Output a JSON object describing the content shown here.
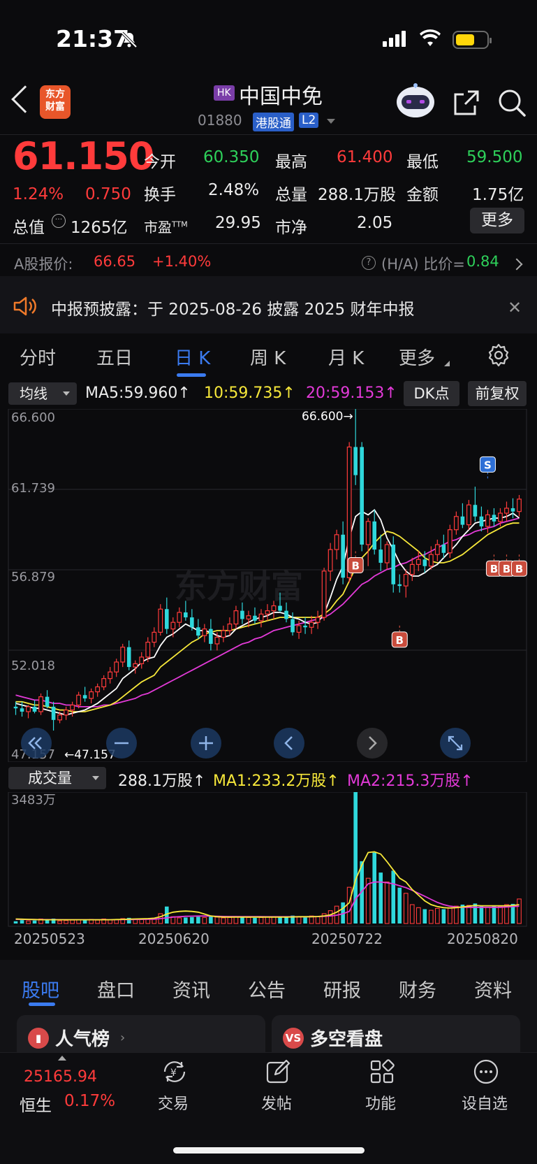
{
  "status": {
    "time": "21:37"
  },
  "header": {
    "logo_line1": "东方",
    "logo_line2": "财富",
    "market_badge": "HK",
    "name": "中国中免",
    "code": "01880",
    "connect_badge": "港股通",
    "level_badge": "L2"
  },
  "quote": {
    "price": "61.150",
    "change_pct": "1.24%",
    "change": "0.750",
    "open_label": "今开",
    "open": "60.350",
    "high_label": "最高",
    "high": "61.400",
    "low_label": "最低",
    "low": "59.500",
    "turnover_label": "换手",
    "turnover": "2.48%",
    "volume_label": "总量",
    "volume": "288.1万股",
    "amount_label": "金额",
    "amount": "1.75亿",
    "mktcap_label": "总值",
    "mktcap": "1265亿",
    "pe_label": "市盈",
    "pe_sup": "TTM",
    "pe": "29.95",
    "pb_label": "市净",
    "pb": "2.05",
    "more": "更多"
  },
  "ashare": {
    "label": "A股报价:",
    "price": "66.65",
    "pct": "+1.40%",
    "ratio_label": "(H/A) 比价=",
    "ratio": "0.84"
  },
  "notice": {
    "text": "中报预披露：于 2025-08-26 披露 2025 财年中报"
  },
  "period_tabs": [
    "分时",
    "五日",
    "日 K",
    "周 K",
    "月 K",
    "更多"
  ],
  "indicator": {
    "select": "均线",
    "ma5": "MA5:59.960↑",
    "ma10": "10:59.735↑",
    "ma20": "20:59.153↑",
    "dk": "DK点",
    "adjust": "前复权"
  },
  "price_axis": {
    "top": "66.600",
    "l2": "61.739",
    "l3": "56.879",
    "l4": "52.018",
    "bottom": "47.157",
    "max_marker": "66.600→",
    "min_marker": "←47.157",
    "watermark": "东方财富"
  },
  "signals": {
    "buy": "B",
    "sell": "S"
  },
  "volume": {
    "select": "成交量",
    "vol": "288.1万股↑",
    "ma1": "MA1:233.2万股↑",
    "ma2": "MA2:215.3万股↑",
    "axis_top": "3483万"
  },
  "dates": [
    "20250523",
    "20250620",
    "20250722",
    "20250820"
  ],
  "bottom_tabs": [
    "股吧",
    "盘口",
    "资讯",
    "公告",
    "研报",
    "财务",
    "资料"
  ],
  "cards": [
    {
      "title": "人气榜",
      "icon": "hot"
    },
    {
      "title": "多空看盘",
      "icon": "VS"
    }
  ],
  "tabbar": {
    "index_value": "25165.94",
    "index_name": "恒生",
    "index_pct": "0.17%",
    "items": [
      "交易",
      "发帖",
      "功能",
      "设自选"
    ]
  },
  "colors": {
    "up": "#ff3b3b",
    "down": "#2ed05a",
    "accent": "#3b7bf0",
    "ma5": "#ffffff",
    "ma10": "#f7e83a",
    "ma20": "#e33ad8",
    "candle_down": "#2fd8dc"
  },
  "chart_data": {
    "type": "candlestick",
    "ylim": [
      47.157,
      66.6
    ],
    "candles": [
      [
        48.6,
        48.9,
        48.1,
        48.5
      ],
      [
        48.5,
        48.9,
        48.0,
        48.3
      ],
      [
        48.3,
        48.7,
        47.9,
        48.6
      ],
      [
        48.6,
        49.0,
        48.2,
        48.3
      ],
      [
        48.3,
        49.4,
        48.1,
        49.2
      ],
      [
        49.2,
        49.6,
        48.5,
        48.6
      ],
      [
        48.6,
        48.9,
        47.157,
        47.8
      ],
      [
        47.8,
        48.3,
        47.6,
        48.1
      ],
      [
        48.1,
        48.6,
        47.8,
        48.4
      ],
      [
        48.4,
        48.9,
        48.0,
        48.7
      ],
      [
        48.7,
        49.5,
        48.5,
        49.3
      ],
      [
        49.3,
        49.8,
        48.9,
        49.1
      ],
      [
        49.1,
        49.7,
        48.8,
        49.5
      ],
      [
        49.5,
        50.0,
        49.2,
        49.8
      ],
      [
        49.8,
        50.5,
        49.6,
        50.3
      ],
      [
        50.3,
        51.0,
        50.0,
        50.7
      ],
      [
        50.7,
        51.5,
        50.4,
        51.3
      ],
      [
        51.3,
        52.4,
        51.0,
        52.2
      ],
      [
        52.2,
        52.6,
        50.8,
        51.0
      ],
      [
        51.0,
        51.4,
        50.6,
        51.2
      ],
      [
        51.2,
        51.9,
        50.9,
        51.6
      ],
      [
        51.6,
        52.8,
        51.3,
        52.5
      ],
      [
        52.5,
        53.4,
        52.2,
        53.1
      ],
      [
        53.1,
        54.8,
        52.9,
        54.5
      ],
      [
        54.5,
        55.2,
        53.0,
        53.3
      ],
      [
        53.3,
        54.0,
        52.8,
        53.7
      ],
      [
        53.7,
        54.6,
        53.4,
        54.3
      ],
      [
        54.3,
        55.0,
        53.8,
        54.0
      ],
      [
        54.0,
        54.5,
        53.2,
        53.4
      ],
      [
        53.4,
        53.9,
        52.7,
        52.9
      ],
      [
        52.9,
        53.6,
        52.5,
        53.3
      ],
      [
        53.3,
        53.9,
        52.0,
        52.4
      ],
      [
        52.4,
        53.1,
        52.0,
        52.8
      ],
      [
        52.8,
        53.5,
        52.5,
        53.2
      ],
      [
        53.2,
        54.0,
        52.9,
        53.6
      ],
      [
        53.6,
        54.7,
        53.3,
        54.4
      ],
      [
        54.4,
        54.9,
        53.6,
        53.9
      ],
      [
        53.9,
        54.4,
        53.4,
        54.1
      ],
      [
        54.1,
        54.6,
        53.6,
        53.8
      ],
      [
        53.8,
        54.5,
        53.4,
        54.2
      ],
      [
        54.2,
        54.8,
        53.8,
        54.4
      ],
      [
        54.4,
        55.0,
        53.9,
        54.7
      ],
      [
        54.7,
        55.5,
        54.3,
        54.4
      ],
      [
        54.4,
        54.9,
        53.7,
        53.9
      ],
      [
        53.9,
        54.3,
        52.9,
        53.1
      ],
      [
        53.1,
        53.8,
        52.7,
        53.5
      ],
      [
        53.5,
        54.0,
        53.0,
        53.4
      ],
      [
        53.4,
        54.1,
        53.0,
        53.7
      ],
      [
        53.7,
        54.4,
        53.3,
        54.0
      ],
      [
        54.0,
        57.0,
        53.8,
        56.8
      ],
      [
        56.8,
        58.5,
        56.2,
        58.1
      ],
      [
        58.1,
        59.3,
        57.5,
        59.0
      ],
      [
        59.0,
        59.8,
        56.0,
        56.4
      ],
      [
        56.4,
        64.6,
        56.1,
        64.3
      ],
      [
        64.3,
        66.6,
        62.0,
        62.6
      ],
      [
        64.3,
        64.6,
        58.0,
        58.4
      ],
      [
        58.4,
        60.0,
        57.1,
        59.8
      ],
      [
        59.8,
        60.5,
        57.8,
        58.1
      ],
      [
        58.1,
        59.0,
        56.8,
        57.3
      ],
      [
        57.3,
        58.6,
        56.9,
        58.4
      ],
      [
        58.4,
        58.9,
        55.5,
        56.0
      ],
      [
        56.0,
        56.6,
        55.5,
        55.9
      ],
      [
        55.9,
        56.9,
        55.2,
        56.6
      ],
      [
        56.6,
        57.6,
        56.2,
        57.2
      ],
      [
        57.2,
        58.0,
        56.8,
        57.5
      ],
      [
        57.5,
        58.0,
        56.7,
        57.1
      ],
      [
        57.1,
        58.3,
        56.9,
        57.8
      ],
      [
        57.8,
        58.7,
        57.4,
        58.4
      ],
      [
        58.4,
        59.0,
        57.6,
        57.9
      ],
      [
        57.9,
        59.6,
        57.6,
        59.3
      ],
      [
        59.3,
        60.4,
        59.0,
        60.1
      ],
      [
        60.1,
        60.9,
        59.4,
        59.6
      ],
      [
        59.6,
        61.1,
        59.3,
        60.8
      ],
      [
        60.8,
        61.9,
        59.8,
        60.1
      ],
      [
        60.1,
        60.7,
        59.2,
        59.5
      ],
      [
        59.5,
        60.5,
        59.1,
        60.2
      ],
      [
        60.2,
        60.6,
        59.5,
        59.8
      ],
      [
        59.8,
        60.6,
        59.5,
        60.3
      ],
      [
        60.3,
        61.0,
        59.8,
        60.6
      ],
      [
        60.6,
        61.2,
        60.0,
        60.4
      ],
      [
        60.4,
        61.4,
        60.1,
        61.15
      ]
    ],
    "ma5": [
      48.8,
      48.7,
      48.6,
      48.5,
      48.5,
      48.4,
      48.3,
      48.2,
      48.1,
      48.2,
      48.3,
      48.4,
      48.6,
      48.8,
      49.1,
      49.4,
      49.7,
      50.3,
      50.6,
      50.9,
      51.3,
      51.5,
      51.6,
      52.3,
      52.8,
      53.0,
      53.3,
      53.6,
      53.4,
      53.2,
      53.2,
      53.1,
      52.9,
      52.8,
      52.9,
      53.3,
      53.5,
      53.7,
      53.9,
      54.0,
      54.1,
      54.3,
      54.3,
      54.2,
      54.0,
      53.9,
      53.7,
      53.6,
      53.7,
      54.2,
      55.2,
      56.3,
      57.1,
      58.8,
      60.1,
      60.4,
      60.2,
      60.5,
      59.9,
      58.8,
      58.1,
      57.3,
      56.8,
      56.5,
      56.5,
      56.7,
      57.0,
      57.2,
      57.6,
      58.0,
      58.4,
      58.9,
      59.3,
      59.7,
      59.8,
      59.9,
      60.0,
      60.0,
      60.1,
      60.3,
      60.0
    ],
    "ma10": [
      48.9,
      48.9,
      48.8,
      48.7,
      48.7,
      48.6,
      48.5,
      48.4,
      48.4,
      48.3,
      48.3,
      48.3,
      48.4,
      48.5,
      48.6,
      48.7,
      48.9,
      49.2,
      49.5,
      49.8,
      50.1,
      50.3,
      50.5,
      51.0,
      51.3,
      51.6,
      51.9,
      52.2,
      52.5,
      52.7,
      53.0,
      53.1,
      53.2,
      53.2,
      53.2,
      53.3,
      53.4,
      53.5,
      53.6,
      53.7,
      53.8,
      53.9,
      54.0,
      54.0,
      54.0,
      54.0,
      54.0,
      54.0,
      54.0,
      54.2,
      54.5,
      55.0,
      55.4,
      56.2,
      57.0,
      57.6,
      58.0,
      58.5,
      58.9,
      59.2,
      59.1,
      58.9,
      58.6,
      58.3,
      58.0,
      57.6,
      57.4,
      57.3,
      57.3,
      57.4,
      57.6,
      57.8,
      58.1,
      58.4,
      58.7,
      59.0,
      59.2,
      59.4,
      59.6,
      59.7,
      59.7
    ],
    "ma20": [
      49.3,
      49.2,
      49.1,
      49.0,
      49.0,
      48.9,
      48.8,
      48.8,
      48.7,
      48.7,
      48.6,
      48.6,
      48.6,
      48.6,
      48.7,
      48.7,
      48.8,
      48.9,
      49.0,
      49.1,
      49.3,
      49.4,
      49.6,
      49.8,
      50.0,
      50.2,
      50.4,
      50.6,
      50.8,
      51.0,
      51.2,
      51.4,
      51.6,
      51.8,
      52.0,
      52.2,
      52.4,
      52.5,
      52.7,
      52.8,
      53.0,
      53.2,
      53.3,
      53.4,
      53.5,
      53.6,
      53.7,
      53.8,
      53.9,
      54.0,
      54.2,
      54.5,
      54.8,
      55.2,
      55.6,
      56.0,
      56.2,
      56.5,
      56.7,
      56.9,
      57.0,
      57.2,
      57.3,
      57.5,
      57.7,
      57.8,
      58.0,
      58.2,
      58.4,
      58.6,
      58.7,
      58.9,
      59.0,
      59.2,
      59.3,
      59.4,
      59.5,
      59.7,
      59.8,
      59.9,
      60.0
    ],
    "volume_ylim": [
      0,
      3483
    ],
    "volumes": [
      60,
      90,
      70,
      80,
      120,
      90,
      130,
      70,
      80,
      90,
      100,
      90,
      110,
      90,
      120,
      100,
      110,
      130,
      150,
      120,
      110,
      130,
      140,
      260,
      450,
      180,
      150,
      160,
      170,
      180,
      160,
      200,
      170,
      150,
      160,
      180,
      170,
      160,
      150,
      160,
      170,
      180,
      160,
      190,
      210,
      170,
      160,
      200,
      180,
      260,
      340,
      460,
      560,
      960,
      3483,
      1650,
      1200,
      1880,
      1350,
      1100,
      1400,
      950,
      800,
      500,
      420,
      380,
      350,
      400,
      380,
      420,
      460,
      500,
      480,
      530,
      460,
      430,
      470,
      450,
      500,
      520,
      650
    ],
    "vol_ma1": [
      120,
      115,
      110,
      105,
      100,
      100,
      100,
      100,
      100,
      100,
      100,
      100,
      100,
      100,
      100,
      100,
      105,
      110,
      115,
      120,
      125,
      130,
      140,
      180,
      250,
      300,
      320,
      330,
      320,
      300,
      250,
      200,
      180,
      170,
      170,
      170,
      170,
      170,
      170,
      170,
      170,
      170,
      170,
      170,
      175,
      180,
      180,
      180,
      185,
      200,
      230,
      300,
      400,
      550,
      1160,
      1550,
      1880,
      1900,
      1840,
      1640,
      1420,
      1200,
      1100,
      900,
      750,
      600,
      500,
      450,
      420,
      410,
      420,
      440,
      460,
      480,
      470,
      470,
      470,
      470,
      470,
      480,
      500
    ],
    "vol_ma2": [
      110,
      110,
      108,
      106,
      104,
      103,
      102,
      101,
      100,
      100,
      100,
      100,
      100,
      100,
      100,
      100,
      102,
      104,
      106,
      108,
      110,
      112,
      115,
      130,
      150,
      170,
      180,
      190,
      195,
      198,
      200,
      195,
      190,
      188,
      186,
      185,
      184,
      183,
      182,
      181,
      180,
      180,
      180,
      180,
      180,
      180,
      180,
      182,
      184,
      190,
      200,
      220,
      260,
      320,
      650,
      850,
      1050,
      1100,
      1100,
      1080,
      1050,
      1000,
      950,
      880,
      800,
      720,
      640,
      560,
      500,
      460,
      440,
      430,
      430,
      430,
      430,
      430,
      430,
      430,
      440,
      450,
      460
    ],
    "signals": [
      {
        "i": 54,
        "type": "B",
        "price": 58.0
      },
      {
        "i": 61,
        "type": "B",
        "price": 53.5
      },
      {
        "i": 75,
        "type": "S",
        "price": 62.4
      },
      {
        "i": 76,
        "type": "B",
        "price": 57.8
      },
      {
        "i": 78,
        "type": "B",
        "price": 57.8
      },
      {
        "i": 80,
        "type": "B",
        "price": 57.8
      }
    ]
  }
}
